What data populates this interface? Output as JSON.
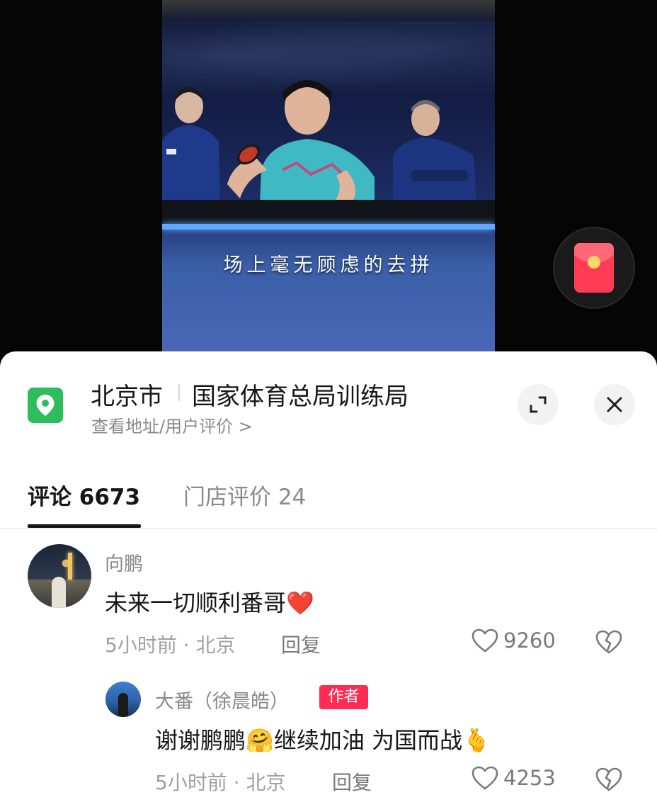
{
  "video": {
    "subtitle": "场上毫无顾虑的去拼"
  },
  "location_card": {
    "city": "北京市",
    "venue": "国家体育总局训练局",
    "sub_link": "查看地址/用户评价 >",
    "icon": "location-pin-icon",
    "icon_color": "#2ebd5c"
  },
  "tabs": [
    {
      "label": "评论 6673",
      "active": true
    },
    {
      "label": "门店评价 24",
      "active": false
    }
  ],
  "comments": [
    {
      "username": "向鹏",
      "text": "未来一切顺利番哥❤️",
      "meta": "5小时前 · 北京",
      "reply_label": "回复",
      "likes": "9260"
    },
    {
      "username": "大番（徐晨皓）",
      "badge": "作者",
      "text": "谢谢鹏鹏🤗继续加油 为国而战🫰",
      "meta": "5小时前 · 北京",
      "reply_label": "回复",
      "likes": "4253"
    }
  ],
  "colors": {
    "accent": "#fe2c55",
    "text_primary": "#161616",
    "text_secondary": "#8a8a8a"
  }
}
